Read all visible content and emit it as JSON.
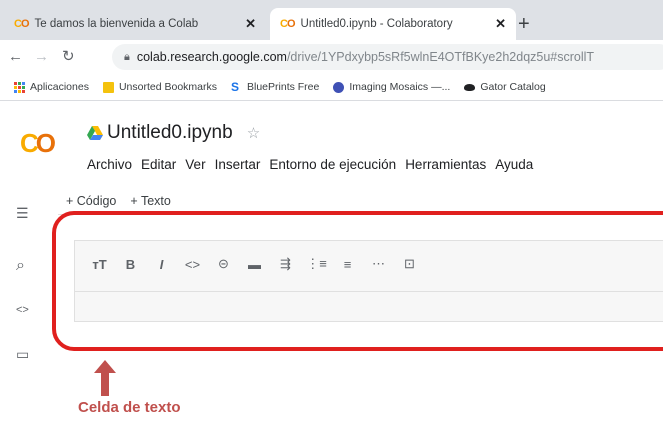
{
  "browser": {
    "tabs": [
      {
        "title": "Te damos la bienvenida a Colab",
        "logo": "CO",
        "close": "✕",
        "active": false
      },
      {
        "title": "Untitled0.ipynb - Colaboratory",
        "logo": "CO",
        "close": "✕",
        "active": true
      }
    ],
    "new_tab": "+",
    "nav": {
      "back": "←",
      "forward": "→",
      "reload": "↻"
    },
    "url": {
      "host": "colab.research.google.com",
      "path": "/drive/1YPdxybp5sRf5wlnE4OTfBKye2h2dqz5u#scrollT"
    },
    "bookmarks": [
      {
        "label": "Aplicaciones",
        "icon": "apps-grid-icon",
        "color": "#ea4335"
      },
      {
        "label": "Unsorted Bookmarks",
        "icon": "folder-icon",
        "color": "#f4c20d"
      },
      {
        "label": "BluePrints Free",
        "icon": "blueprints-icon",
        "color": "#1a73e8"
      },
      {
        "label": "Imaging Mosaics —...",
        "icon": "imaging-icon",
        "color": "#3f51b5"
      },
      {
        "label": "Gator Catalog",
        "icon": "gator-icon",
        "color": "#202124"
      }
    ]
  },
  "colab": {
    "logo": "CO",
    "notebook_title": "Untitled0.ipynb",
    "star": "☆",
    "menu": [
      "Archivo",
      "Editar",
      "Ver",
      "Insertar",
      "Entorno de ejecución",
      "Herramientas",
      "Ayuda"
    ],
    "add_code": "+ Código",
    "add_text": "+ Texto",
    "sidebar_icons": [
      "☰",
      "⌕",
      "<>",
      "▭"
    ],
    "text_toolbar": [
      {
        "glyph": "тT",
        "icon": "text-size-icon"
      },
      {
        "glyph": "B",
        "icon": "bold-icon"
      },
      {
        "glyph": "I",
        "icon": "italic-icon"
      },
      {
        "glyph": "<>",
        "icon": "code-icon"
      },
      {
        "glyph": "⊝",
        "icon": "link-icon"
      },
      {
        "glyph": "▬",
        "icon": "image-icon"
      },
      {
        "glyph": "⇶",
        "icon": "indent-icon"
      },
      {
        "glyph": "⋮≡",
        "icon": "numbered-list-icon"
      },
      {
        "glyph": "≡",
        "icon": "bulleted-list-icon"
      },
      {
        "glyph": "⋯",
        "icon": "horizontal-rule-icon"
      },
      {
        "glyph": "⊡",
        "icon": "emoji-icon"
      }
    ]
  },
  "annotation": {
    "label": "Celda de texto",
    "color": "#e0201e"
  }
}
